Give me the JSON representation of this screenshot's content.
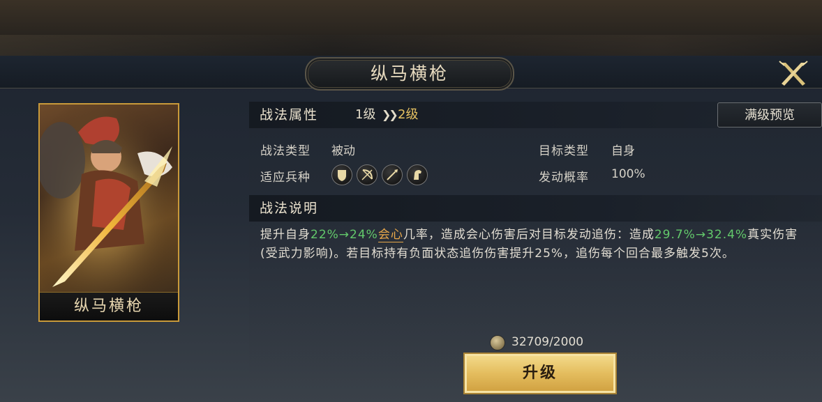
{
  "window": {
    "title": "纵马横枪",
    "close_icon": "close-x-icon"
  },
  "card": {
    "name": "纵马横枪",
    "art": "general-portrait"
  },
  "skill_attrs": {
    "section_title": "战法属性",
    "level_from": "1级",
    "level_arrow": "»",
    "level_to": "2级",
    "preview_button": "满级预览",
    "type_label": "战法类型",
    "type_value": "被动",
    "target_label": "目标类型",
    "target_value": "自身",
    "troops_label": "适应兵种",
    "troops": [
      "shield-icon",
      "bow-icon",
      "spear-icon",
      "horse-icon"
    ],
    "rate_label": "发动概率",
    "rate_value": "100%"
  },
  "skill_desc": {
    "section_title": "战法说明",
    "segments": [
      {
        "text": "提升自身",
        "style": "normal"
      },
      {
        "text": "22%→24%",
        "style": "green"
      },
      {
        "text": "会心",
        "style": "orange"
      },
      {
        "text": "几率，造成会心伤害后对目标发动追伤：造成",
        "style": "normal"
      },
      {
        "text": "29.7%→32.4%",
        "style": "green"
      },
      {
        "text": "真实伤害(受武力影响)。若目标持有负面状态追伤伤害提升25%，追伤每个回合最多触发5次。",
        "style": "normal"
      }
    ]
  },
  "cost": {
    "coin_icon": "coin-icon",
    "text": "32709/2000"
  },
  "upgrade_button": "升级",
  "colors": {
    "accent_gold": "#e6c262",
    "highlight_green": "#63c96b",
    "highlight_orange": "#e8a84a",
    "button_gold": "#e4bd5e"
  }
}
